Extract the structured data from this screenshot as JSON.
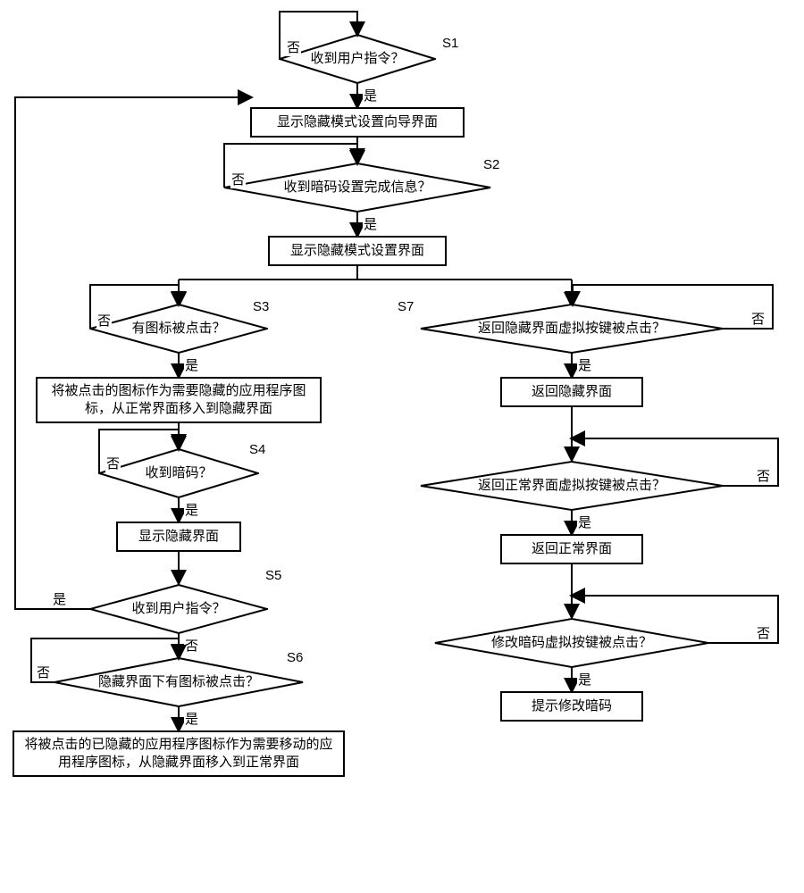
{
  "labels": {
    "yes": "是",
    "no": "否"
  },
  "steps": {
    "s1": "S1",
    "s2": "S2",
    "s3": "S3",
    "s4": "S4",
    "s5": "S5",
    "s6": "S6",
    "s7": "S7"
  },
  "nodes": {
    "d1": "收到用户指令？",
    "p1": "显示隐藏模式设置向导界面",
    "d2": "收到暗码设置完成信息？",
    "p2": "显示隐藏模式设置界面",
    "d3": "有图标被点击？",
    "p3": "将被点击的图标作为需要隐藏的应用程序图标，从正常界面移入到隐藏界面",
    "d4": "收到暗码？",
    "p4": "显示隐藏界面",
    "d5": "收到用户指令？",
    "d6": "隐藏界面下有图标被点击？",
    "p5": "将被点击的已隐藏的应用程序图标作为需要移动的应用程序图标，从隐藏界面移入到正常界面",
    "d7": "返回隐藏界面虚拟按键被点击？",
    "p6": "返回隐藏界面",
    "d8": "返回正常界面虚拟按键被点击？",
    "p7": "返回正常界面",
    "d9": "修改暗码虚拟按键被点击？",
    "p8": "提示修改暗码"
  }
}
